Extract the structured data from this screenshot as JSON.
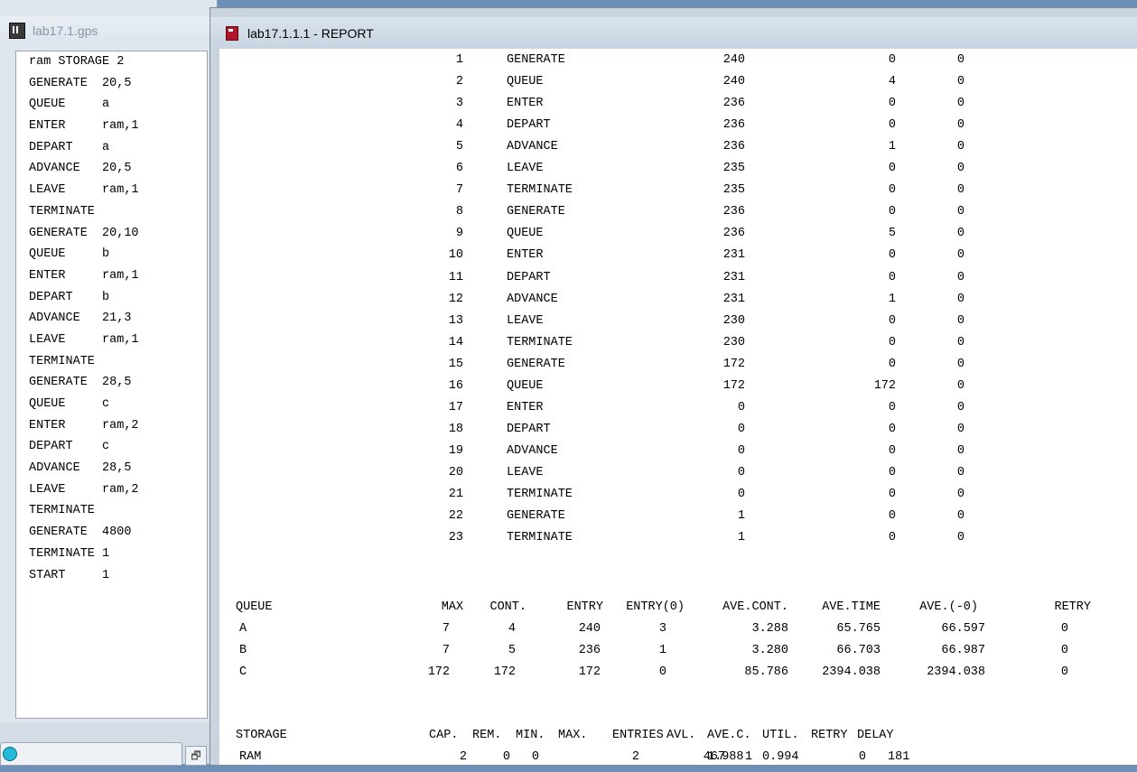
{
  "model_window": {
    "title": "lab17.1.gps",
    "lines": [
      "ram STORAGE 2",
      "GENERATE  20,5",
      "QUEUE     a",
      "ENTER     ram,1",
      "DEPART    a",
      "ADVANCE   20,5",
      "LEAVE     ram,1",
      "TERMINATE",
      "GENERATE  20,10",
      "QUEUE     b",
      "ENTER     ram,1",
      "DEPART    b",
      "ADVANCE   21,3",
      "LEAVE     ram,1",
      "TERMINATE",
      "GENERATE  28,5",
      "QUEUE     c",
      "ENTER     ram,2",
      "DEPART    c",
      "ADVANCE   28,5",
      "LEAVE     ram,2",
      "TERMINATE",
      "GENERATE  4800",
      "TERMINATE 1",
      "START     1"
    ]
  },
  "report_window": {
    "title": "lab17.1.1.1 - REPORT",
    "blocks": [
      {
        "loc": "1",
        "type": "GENERATE",
        "entry": "240",
        "current": "0",
        "retry": "0"
      },
      {
        "loc": "2",
        "type": "QUEUE",
        "entry": "240",
        "current": "4",
        "retry": "0"
      },
      {
        "loc": "3",
        "type": "ENTER",
        "entry": "236",
        "current": "0",
        "retry": "0"
      },
      {
        "loc": "4",
        "type": "DEPART",
        "entry": "236",
        "current": "0",
        "retry": "0"
      },
      {
        "loc": "5",
        "type": "ADVANCE",
        "entry": "236",
        "current": "1",
        "retry": "0"
      },
      {
        "loc": "6",
        "type": "LEAVE",
        "entry": "235",
        "current": "0",
        "retry": "0"
      },
      {
        "loc": "7",
        "type": "TERMINATE",
        "entry": "235",
        "current": "0",
        "retry": "0"
      },
      {
        "loc": "8",
        "type": "GENERATE",
        "entry": "236",
        "current": "0",
        "retry": "0"
      },
      {
        "loc": "9",
        "type": "QUEUE",
        "entry": "236",
        "current": "5",
        "retry": "0"
      },
      {
        "loc": "10",
        "type": "ENTER",
        "entry": "231",
        "current": "0",
        "retry": "0"
      },
      {
        "loc": "11",
        "type": "DEPART",
        "entry": "231",
        "current": "0",
        "retry": "0"
      },
      {
        "loc": "12",
        "type": "ADVANCE",
        "entry": "231",
        "current": "1",
        "retry": "0"
      },
      {
        "loc": "13",
        "type": "LEAVE",
        "entry": "230",
        "current": "0",
        "retry": "0"
      },
      {
        "loc": "14",
        "type": "TERMINATE",
        "entry": "230",
        "current": "0",
        "retry": "0"
      },
      {
        "loc": "15",
        "type": "GENERATE",
        "entry": "172",
        "current": "0",
        "retry": "0"
      },
      {
        "loc": "16",
        "type": "QUEUE",
        "entry": "172",
        "current": "172",
        "retry": "0"
      },
      {
        "loc": "17",
        "type": "ENTER",
        "entry": "0",
        "current": "0",
        "retry": "0"
      },
      {
        "loc": "18",
        "type": "DEPART",
        "entry": "0",
        "current": "0",
        "retry": "0"
      },
      {
        "loc": "19",
        "type": "ADVANCE",
        "entry": "0",
        "current": "0",
        "retry": "0"
      },
      {
        "loc": "20",
        "type": "LEAVE",
        "entry": "0",
        "current": "0",
        "retry": "0"
      },
      {
        "loc": "21",
        "type": "TERMINATE",
        "entry": "0",
        "current": "0",
        "retry": "0"
      },
      {
        "loc": "22",
        "type": "GENERATE",
        "entry": "1",
        "current": "0",
        "retry": "0"
      },
      {
        "loc": "23",
        "type": "TERMINATE",
        "entry": "1",
        "current": "0",
        "retry": "0"
      }
    ],
    "queue_header": {
      "label": "QUEUE",
      "max": "MAX",
      "cont": "CONT.",
      "entry": "ENTRY",
      "entry0": "ENTRY(0)",
      "avecont": "AVE.CONT.",
      "avetime": "AVE.TIME",
      "ave0": "AVE.(-0)",
      "retry": "RETRY"
    },
    "queues": [
      {
        "name": "A",
        "max": "7",
        "cont": "4",
        "entry": "240",
        "entry0": "3",
        "avecont": "3.288",
        "avetime": "65.765",
        "ave0": "66.597",
        "retry": "0"
      },
      {
        "name": "B",
        "max": "7",
        "cont": "5",
        "entry": "236",
        "entry0": "1",
        "avecont": "3.280",
        "avetime": "66.703",
        "ave0": "66.987",
        "retry": "0"
      },
      {
        "name": "C",
        "max": "172",
        "cont": "172",
        "entry": "172",
        "entry0": "0",
        "avecont": "85.786",
        "avetime": "2394.038",
        "ave0": "2394.038",
        "retry": "0"
      }
    ],
    "storage_header": {
      "label": "STORAGE",
      "cap": "CAP.",
      "rem": "REM.",
      "min": "MIN.",
      "max": "MAX.",
      "entries": "ENTRIES",
      "avl": "AVL.",
      "avec": "AVE.C.",
      "util": "UTIL.",
      "retry": "RETRY",
      "delay": "DELAY"
    },
    "storages": [
      {
        "name": "RAM",
        "cap": "2",
        "rem": "0",
        "min": "0",
        "max": "2",
        "entries": "467",
        "avl": "1",
        "avec": "1.988",
        "util": "0.994",
        "retry": "0",
        "delay": "181"
      }
    ]
  }
}
